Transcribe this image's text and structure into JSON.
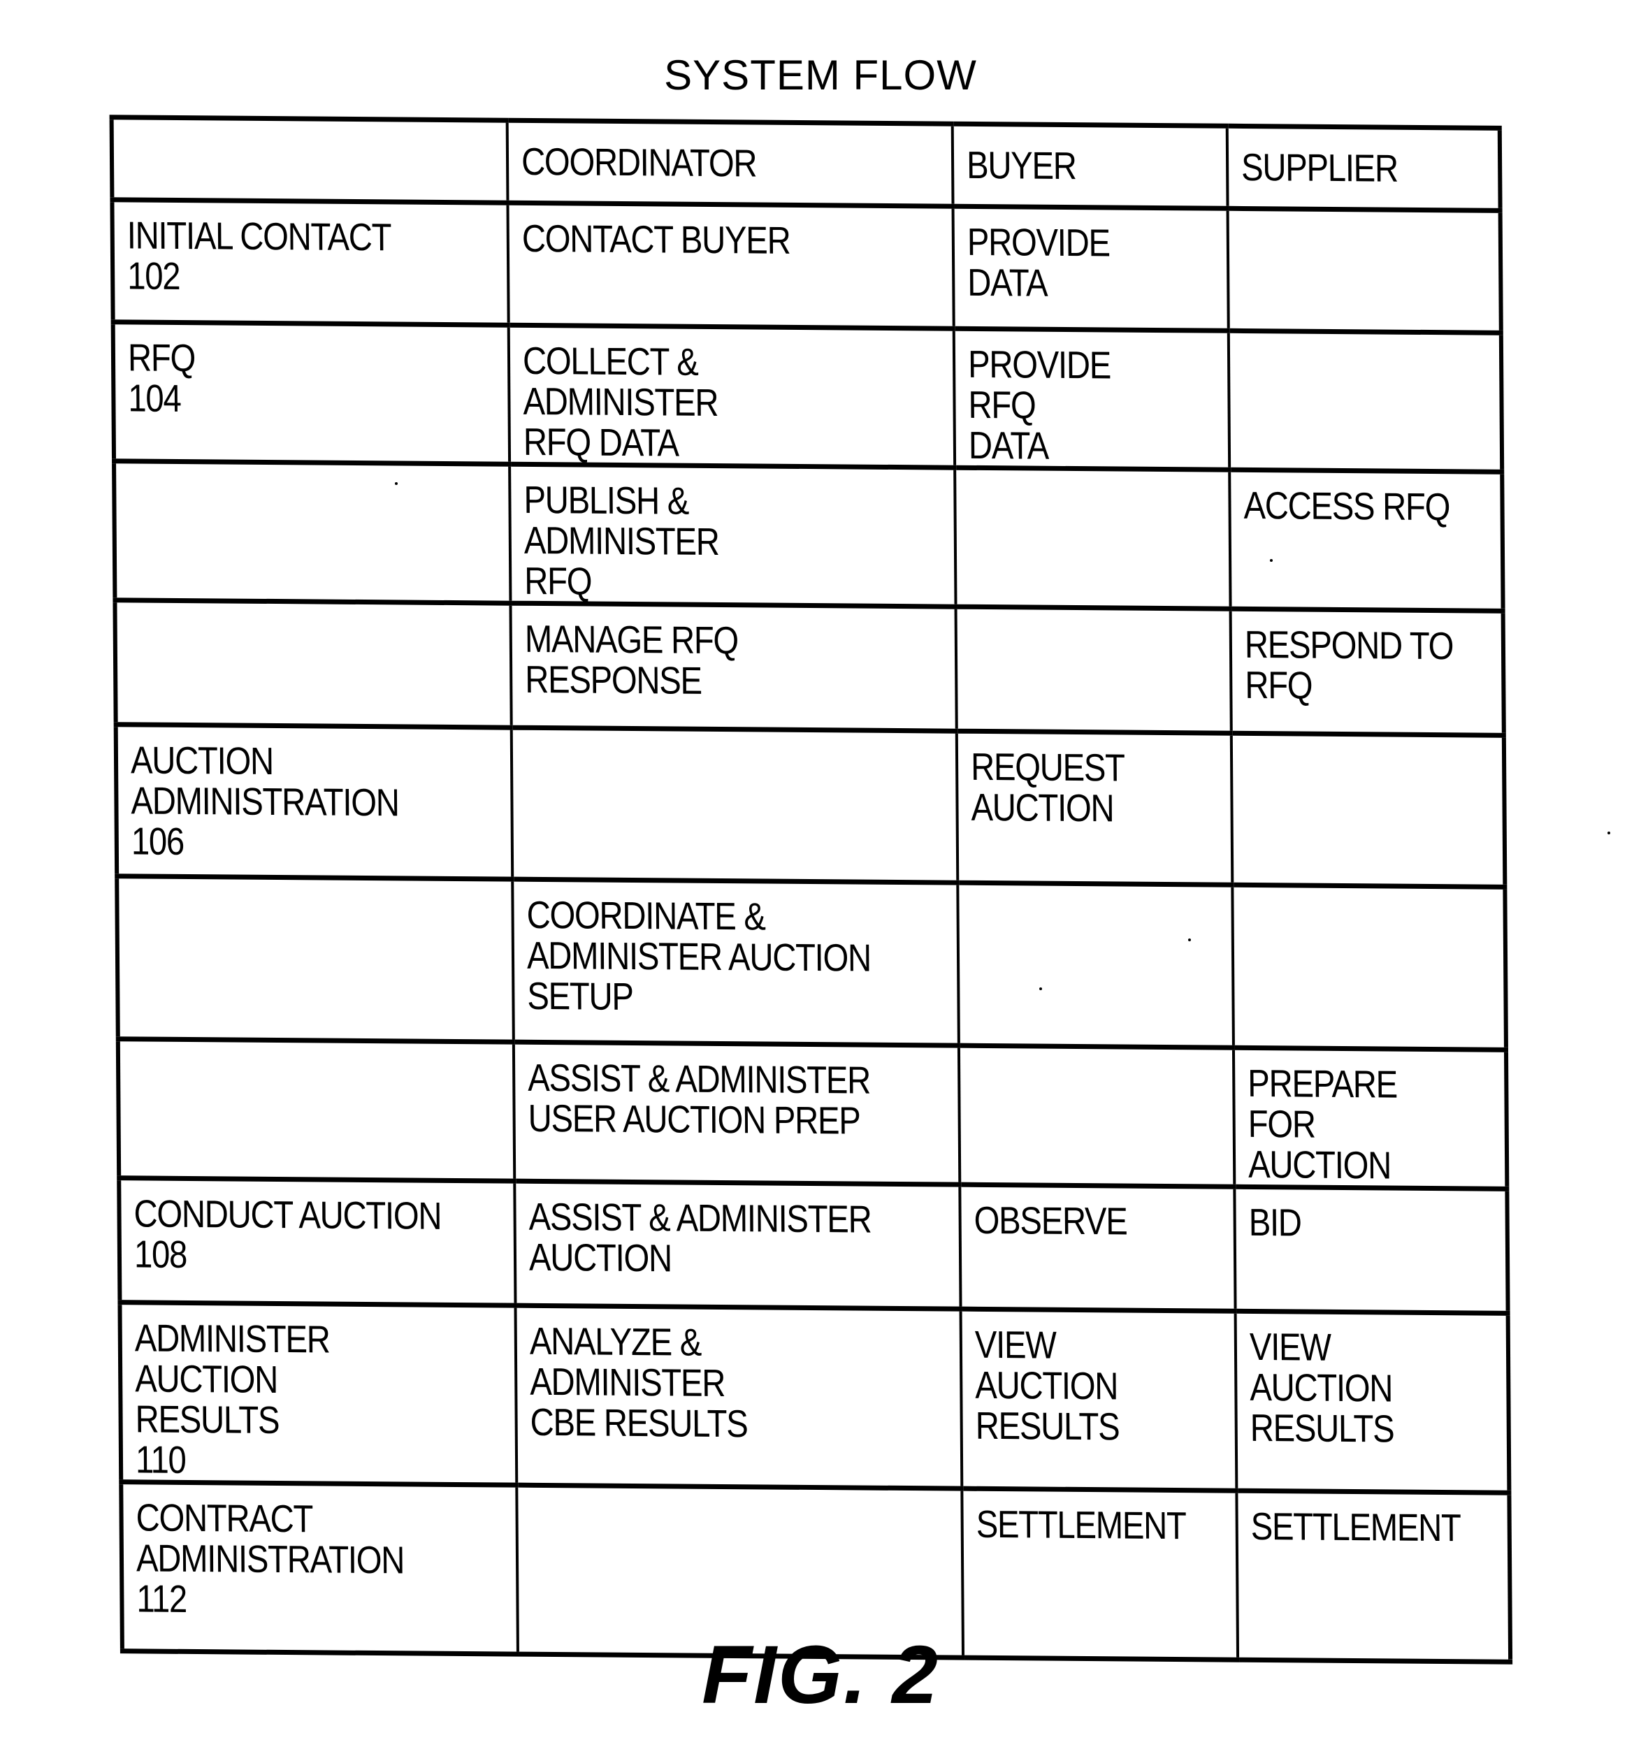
{
  "title": "SYSTEM FLOW",
  "figure_label": "FIG. 2",
  "table": {
    "columns": [
      "",
      "COORDINATOR",
      "BUYER",
      "SUPPLIER"
    ],
    "rows": [
      {
        "stage": "INITIAL CONTACT\n102",
        "coordinator": "CONTACT BUYER",
        "buyer": "PROVIDE DATA",
        "supplier": ""
      },
      {
        "stage": "RFQ\n104",
        "coordinator": "COLLECT & ADMINISTER\nRFQ DATA",
        "buyer": "PROVIDE RFQ\nDATA",
        "supplier": ""
      },
      {
        "stage": "",
        "coordinator": "PUBLISH & ADMINISTER\nRFQ",
        "buyer": "",
        "supplier": "ACCESS RFQ"
      },
      {
        "stage": "",
        "coordinator": "MANAGE RFQ RESPONSE",
        "buyer": "",
        "supplier": "RESPOND TO\nRFQ"
      },
      {
        "stage": "AUCTION\nADMINISTRATION\n106",
        "coordinator": "",
        "buyer": "REQUEST\nAUCTION",
        "supplier": ""
      },
      {
        "stage": "",
        "coordinator": "COORDINATE &\nADMINISTER AUCTION\nSETUP",
        "buyer": "",
        "supplier": ""
      },
      {
        "stage": "",
        "coordinator": "ASSIST & ADMINISTER\nUSER AUCTION PREP",
        "buyer": "",
        "supplier": "PREPARE\nFOR AUCTION"
      },
      {
        "stage": "CONDUCT AUCTION\n108",
        "coordinator": "ASSIST & ADMINISTER\nAUCTION",
        "buyer": "OBSERVE",
        "supplier": "BID"
      },
      {
        "stage": "ADMINISTER AUCTION\nRESULTS\n110",
        "coordinator": "ANALYZE & ADMINISTER\nCBE RESULTS",
        "buyer": "VIEW AUCTION\nRESULTS",
        "supplier": "VIEW AUCTION\nRESULTS"
      },
      {
        "stage": "CONTRACT\nADMINISTRATION\n112",
        "coordinator": "",
        "buyer": "SETTLEMENT",
        "supplier": "SETTLEMENT"
      }
    ]
  }
}
